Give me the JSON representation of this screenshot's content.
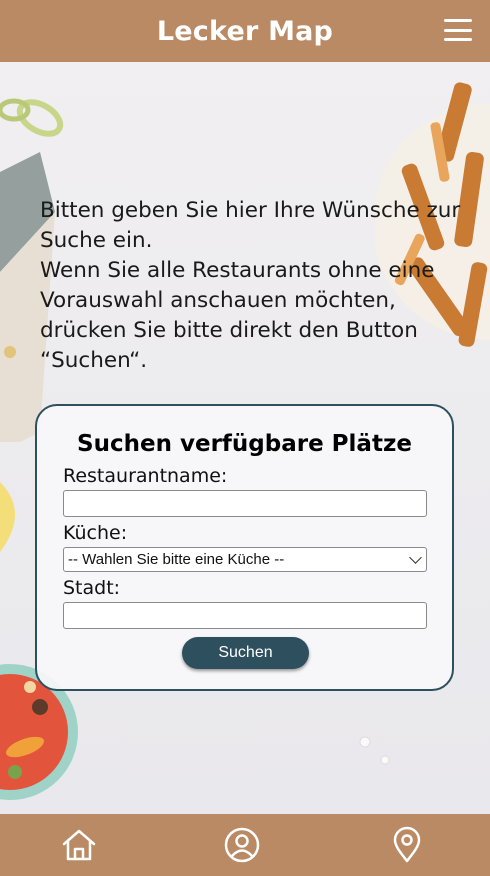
{
  "header": {
    "title": "Lecker Map",
    "menu_icon": "hamburger-menu-icon"
  },
  "intro": {
    "line1": "Bitten geben Sie hier Ihre Wünsche zur Suche ein.",
    "line2": "Wenn Sie alle Restaurants ohne eine Vorauswahl anschauen möchten, drücken Sie bitte direkt den Button “Suchen“."
  },
  "search_form": {
    "title": "Suchen verfügbare Plätze",
    "restaurant_label": "Restaurantname:",
    "restaurant_value": "",
    "cuisine_label": "Küche:",
    "cuisine_selected": "-- Wahlen Sie bitte eine Küche --",
    "city_label": "Stadt:",
    "city_value": "",
    "submit_label": "Suchen"
  },
  "bottom_nav": {
    "items": [
      {
        "icon": "home-icon"
      },
      {
        "icon": "profile-icon"
      },
      {
        "icon": "location-pin-icon"
      }
    ]
  },
  "colors": {
    "brand": "#b98a64",
    "accent": "#2d4f5e",
    "background": "#ece9ec"
  }
}
